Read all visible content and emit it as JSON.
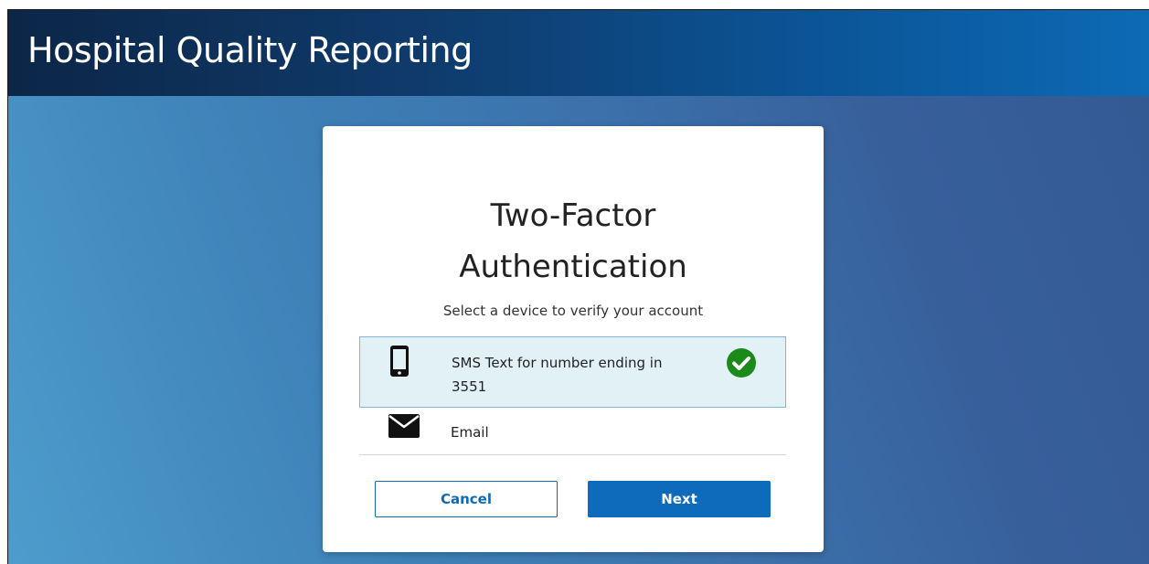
{
  "header": {
    "title": "Hospital Quality Reporting"
  },
  "card": {
    "title_line1": "Two-Factor",
    "title_line2": "Authentication",
    "subtitle": "Select a device to verify your account",
    "devices": [
      {
        "label_line1": "SMS Text for number ending in",
        "label_line2": "3551",
        "icon": "mobile-phone-icon",
        "selected": true
      },
      {
        "label": "Email",
        "icon": "envelope-icon",
        "selected": false
      }
    ],
    "cancel_label": "Cancel",
    "next_label": "Next"
  },
  "colors": {
    "header_dark": "#0c2647",
    "header_light": "#0d6ab5",
    "primary": "#0e6aba",
    "selected_bg": "#e1f1f6",
    "check_green": "#1a8a1a"
  }
}
